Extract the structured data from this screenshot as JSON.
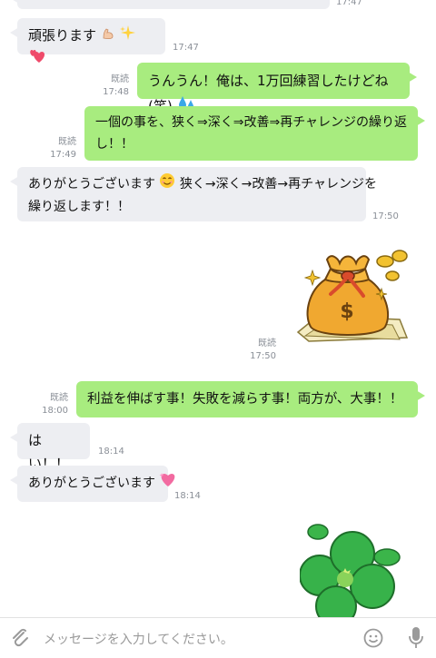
{
  "messages": [
    {
      "type": "in",
      "text": "",
      "time": "17:47"
    },
    {
      "type": "in",
      "text": "頑張ります",
      "time": "17:47"
    },
    {
      "type": "out",
      "read": "既読",
      "time": "17:48",
      "text": "うんうん！俺は、1万回練習したけどね(笑)"
    },
    {
      "type": "out",
      "read": "既読",
      "time": "17:49",
      "line1": "一個の事を、狭く⇒深く⇒改善⇒再チャレンジの繰り返",
      "line2": "し！！"
    },
    {
      "type": "in",
      "time": "17:50",
      "line1a": "ありがとうございます",
      "line1b": "狭く→深く→改善→再チャレンジを",
      "line2": "繰り返します！！"
    },
    {
      "type": "sticker",
      "read": "既読",
      "time": "17:50",
      "name": "money-bag-sticker"
    },
    {
      "type": "out",
      "read": "既読",
      "time": "18:00",
      "text": "利益を伸ばす事！失敗を減らす事！両方が、大事！！"
    },
    {
      "type": "in",
      "time": "18:14",
      "text": "はい！！"
    },
    {
      "type": "in",
      "time": "18:14",
      "text": "ありがとうございます"
    },
    {
      "type": "sticker",
      "name": "clover-sticker"
    }
  ],
  "input": {
    "placeholder": "メッセージを入力してください。",
    "icons": [
      "paperclip-icon",
      "smiley-icon",
      "microphone-icon"
    ]
  },
  "colors": {
    "out_bubble": "#a8ec7f",
    "in_bubble": "#edeef2",
    "meta": "#8a8f97"
  }
}
